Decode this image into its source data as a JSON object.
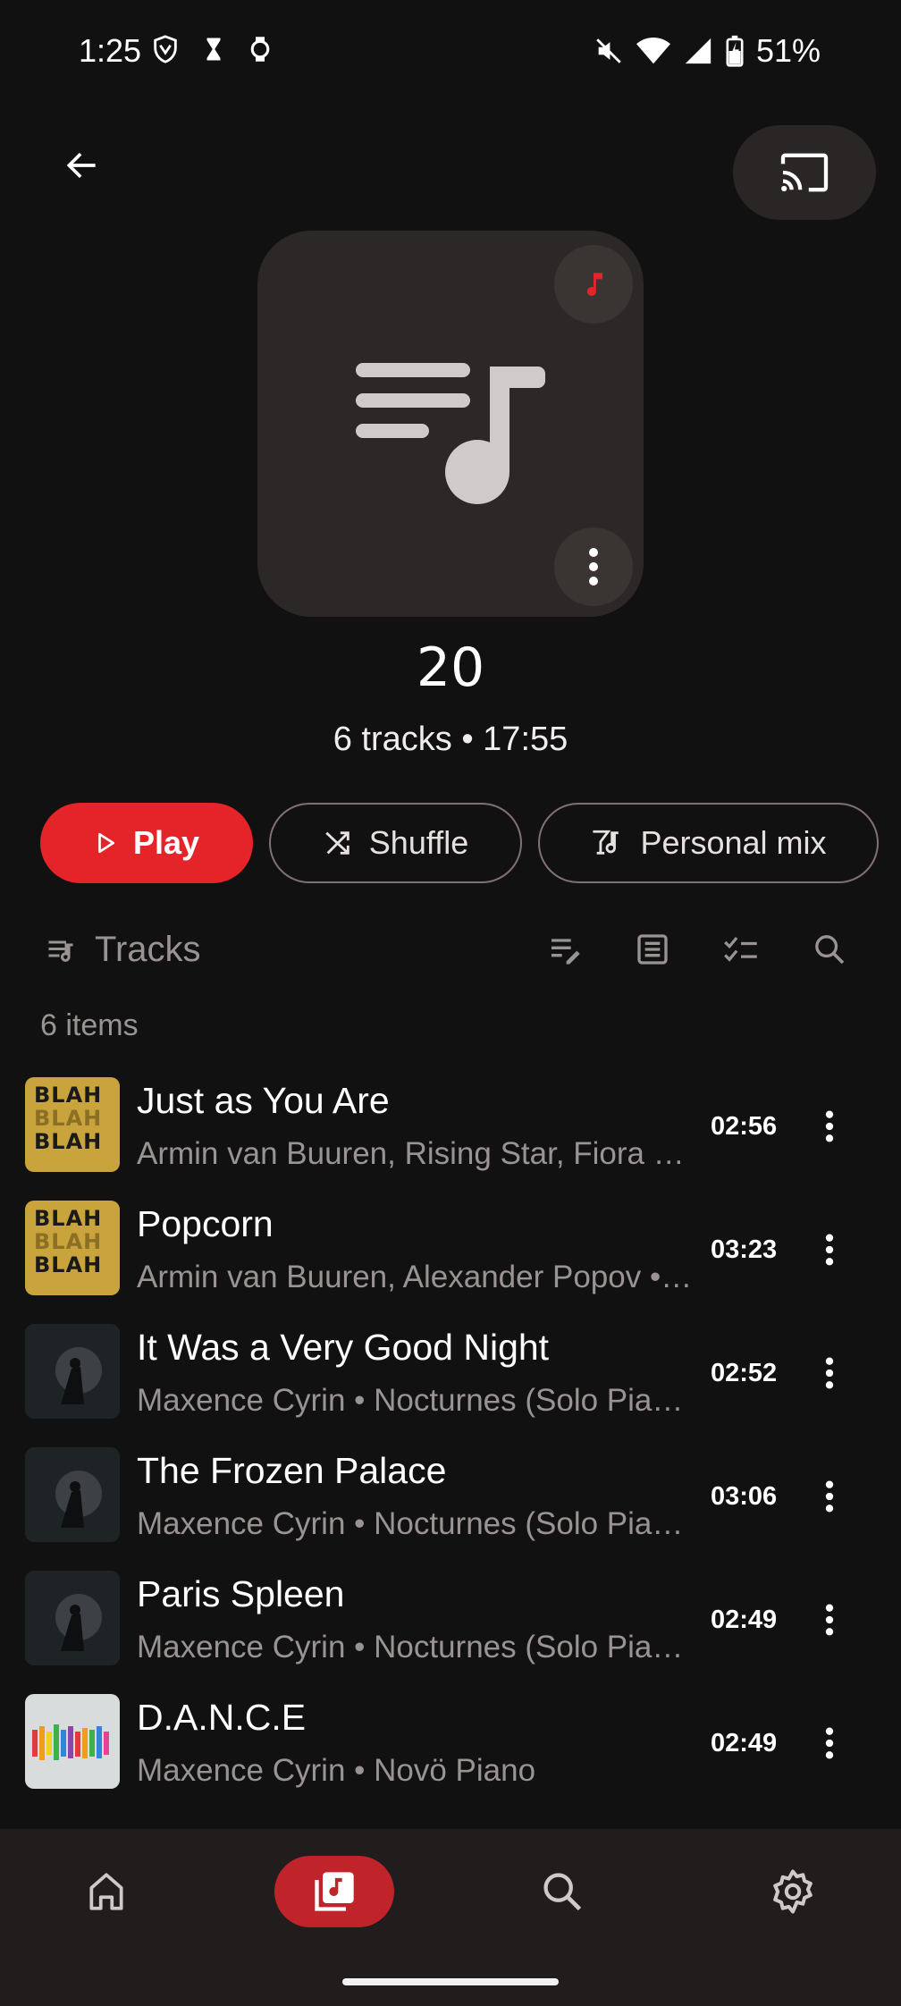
{
  "status_bar": {
    "time": "1:25",
    "battery": "51%"
  },
  "playlist": {
    "title": "20",
    "meta": "6 tracks • 17:55"
  },
  "actions": {
    "play": "Play",
    "shuffle": "Shuffle",
    "personal_mix": "Personal mix"
  },
  "tracks_section": {
    "label": "Tracks",
    "count": "6 items"
  },
  "tracks": [
    {
      "title": "Just as You Are",
      "subtitle": "Armin van Buuren, Rising Star, Fiora • Blah Blah Blah",
      "duration": "02:56",
      "art": "blah"
    },
    {
      "title": "Popcorn",
      "subtitle": "Armin van Buuren, Alexander Popov • Blah Blah Blah",
      "duration": "03:23",
      "art": "blah"
    },
    {
      "title": "It Was a Very Good Night",
      "subtitle": "Maxence Cyrin • Nocturnes (Solo Piano)",
      "duration": "02:52",
      "art": "piano"
    },
    {
      "title": "The Frozen Palace",
      "subtitle": "Maxence Cyrin • Nocturnes (Solo Piano)",
      "duration": "03:06",
      "art": "piano"
    },
    {
      "title": "Paris Spleen",
      "subtitle": "Maxence Cyrin • Nocturnes (Solo Piano)",
      "duration": "02:49",
      "art": "piano"
    },
    {
      "title": "D.A.N.C.E",
      "subtitle": "Maxence Cyrin • Novö Piano",
      "duration": "02:49",
      "art": "dance"
    }
  ],
  "album_art_text": {
    "blah": [
      "BLAH",
      "BLAH",
      "BLAH"
    ]
  },
  "colors": {
    "accent": "#e5242a",
    "background": "#121111",
    "nav_active": "#c0242a"
  },
  "nav": [
    "home-icon",
    "library-icon",
    "search-icon",
    "settings-icon"
  ]
}
